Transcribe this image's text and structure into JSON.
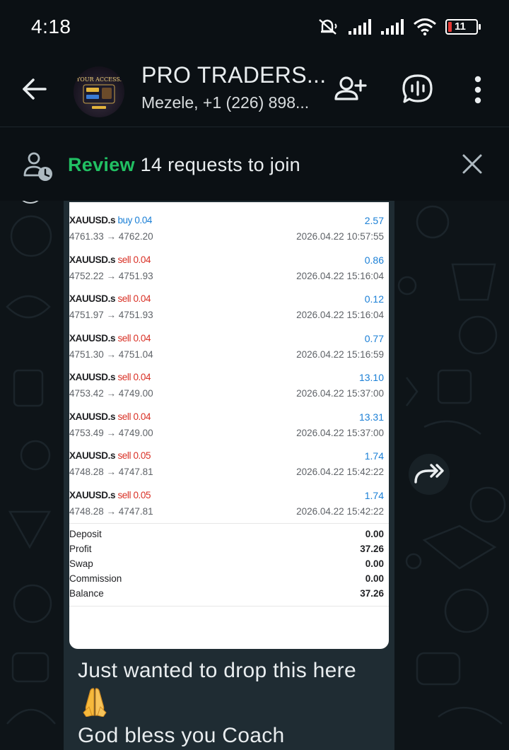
{
  "status_bar": {
    "time": "4:18",
    "battery": "11"
  },
  "header": {
    "title": "PRO TRADERS...",
    "subtitle": "Mezele, +1 (226) 898...",
    "avatar_text": "YOUR ACCESS."
  },
  "review_bar": {
    "highlight": "Review",
    "text": " 14 requests to join"
  },
  "trades": [
    {
      "symbol": "XAUUSD.s",
      "side": "buy 0.04",
      "type": "buy",
      "price": "4761.33 → 4762.20",
      "profit": "2.57",
      "time": "2026.04.22 10:57:55"
    },
    {
      "symbol": "XAUUSD.s",
      "side": "sell 0.04",
      "type": "sell",
      "price": "4752.22 → 4751.93",
      "profit": "0.86",
      "time": "2026.04.22 15:16:04"
    },
    {
      "symbol": "XAUUSD.s",
      "side": "sell 0.04",
      "type": "sell",
      "price": "4751.97 → 4751.93",
      "profit": "0.12",
      "time": "2026.04.22 15:16:04"
    },
    {
      "symbol": "XAUUSD.s",
      "side": "sell 0.04",
      "type": "sell",
      "price": "4751.30 → 4751.04",
      "profit": "0.77",
      "time": "2026.04.22 15:16:59"
    },
    {
      "symbol": "XAUUSD.s",
      "side": "sell 0.04",
      "type": "sell",
      "price": "4753.42 → 4749.00",
      "profit": "13.10",
      "time": "2026.04.22 15:37:00"
    },
    {
      "symbol": "XAUUSD.s",
      "side": "sell 0.04",
      "type": "sell",
      "price": "4753.49 → 4749.00",
      "profit": "13.31",
      "time": "2026.04.22 15:37:00"
    },
    {
      "symbol": "XAUUSD.s",
      "side": "sell 0.05",
      "type": "sell",
      "price": "4748.28 → 4747.81",
      "profit": "1.74",
      "time": "2026.04.22 15:42:22"
    },
    {
      "symbol": "XAUUSD.s",
      "side": "sell 0.05",
      "type": "sell",
      "price": "4748.28 → 4747.81",
      "profit": "1.74",
      "time": "2026.04.22 15:42:22"
    }
  ],
  "summary": [
    {
      "label": "Deposit",
      "value": "0.00"
    },
    {
      "label": "Profit",
      "value": "37.26"
    },
    {
      "label": "Swap",
      "value": "0.00"
    },
    {
      "label": "Commission",
      "value": "0.00"
    },
    {
      "label": "Balance",
      "value": "37.26"
    }
  ],
  "message": {
    "line1": "Just wanted to drop this here",
    "emoji": "🙏",
    "line2": "God bless you Coach"
  },
  "colors": {
    "accent_green": "#21c063",
    "buy_blue": "#1a7fd6",
    "sell_red": "#d93025",
    "bubble": "#1f2c33"
  },
  "icons": [
    "back-arrow-icon",
    "add-person-icon",
    "voice-chat-icon",
    "more-options-icon",
    "pending-person-icon",
    "close-icon",
    "forward-icon"
  ]
}
